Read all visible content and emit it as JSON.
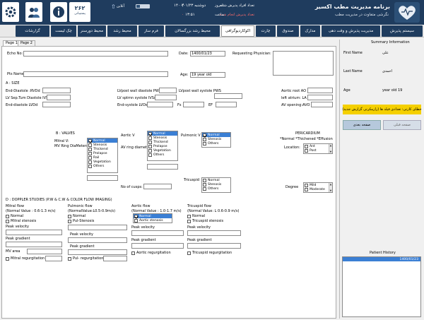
{
  "header": {
    "brand_title": "برنامه مدیریت مطب اکسیر",
    "brand_subtitle": "نگرشی متفاوت در مدیریت مطب",
    "queue_label": "تعداد افراد پذیرش شده",
    "queue_value": "۳",
    "done_label": "تعداد پذیرش انجام شده",
    "done_value": "۰",
    "today_label": "امروز:",
    "today_value": "دوشنبه ۱۴۰۰/۰۱/۲۳",
    "time_label": "ساعت",
    "time_value": "۱۳:۵۱",
    "badge_number": "۲۶۲",
    "badge_label": "پشتیبانی",
    "online_label": "آنلاین",
    "colors": {
      "header_bg": "#1f3c5e",
      "alert": "#ff6b6b"
    }
  },
  "menu": [
    {
      "label": "سیستم پذیرش"
    },
    {
      "label": "مدیریت پذیرش و وقت دهی"
    },
    {
      "label": "مدارک"
    },
    {
      "label": "صندوق"
    },
    {
      "label": "چارت"
    },
    {
      "label": "اکوکاردیوگرافی"
    },
    {
      "label": "محیط رشد بزرگسالان"
    },
    {
      "label": "فرم ساز"
    },
    {
      "label": "محیط رشد"
    },
    {
      "label": "محیط دورسنر"
    },
    {
      "label": "چک لیست"
    },
    {
      "label": "گزارشات"
    }
  ],
  "tabs": [
    "Page 1",
    "Page 2"
  ],
  "form": {
    "echo_no": "Echo No:",
    "date_label": "Date:",
    "date_value": "1400/01/23",
    "requesting_physician": "Requesting Physician:",
    "pts_name": "Pts Name:",
    "age_label": "Age:",
    "age_value": "19 year old",
    "section_a": "A : SIZE",
    "size_fields": {
      "end_diastole_rvd": "End-Diastole :RVDd",
      "lv_sep_tum": "LV Sep.Tum Diastole IVSd",
      "end_diastole_lvd": "End-diastole LVDd",
      "lv_post_wall_diastole": "LVpost wall diastole PWD",
      "lv_post_wall_systole": "LVpost wall systole PWS",
      "lv_sptmn_systole": "LV sptmn systole IVSs",
      "end_systole_lvd": "End-systole LVDs",
      "fs": "Fs",
      "ef": "EF",
      "aortic_root": "Aortic root AO",
      "left_atrium": "left atrium: LA",
      "av_opening": "AV opening:AVO"
    },
    "section_b": "B : VALVES",
    "mitral_v": "Mitral V:",
    "mv_ring": "MV Ring DiaMeters:",
    "mitral_options": [
      {
        "label": "Normal",
        "checked": true,
        "selected": true
      },
      {
        "label": "Stenosis",
        "checked": false
      },
      {
        "label": "Thickend",
        "checked": false
      },
      {
        "label": "Prolapse",
        "checked": false
      },
      {
        "label": "Rail",
        "checked": false
      },
      {
        "label": "Vegetation",
        "checked": false
      },
      {
        "label": "Others",
        "checked": false
      }
    ],
    "aortic_v": "Aortic V",
    "av_ring": "AV ring diameter:",
    "aortic_options": [
      {
        "label": "Normal",
        "checked": true,
        "selected": true
      },
      {
        "label": "Stenosis",
        "checked": false
      },
      {
        "label": "Thickend",
        "checked": false
      },
      {
        "label": "Prolapse",
        "checked": false
      },
      {
        "label": "Vegetation",
        "checked": false
      },
      {
        "label": "Others",
        "checked": false
      }
    ],
    "pulmonic_v": "Pulmonic V",
    "pulmonic_options": [
      {
        "label": "Normal",
        "checked": true,
        "selected": true
      },
      {
        "label": "Stenosis",
        "checked": false
      },
      {
        "label": "Others",
        "checked": false
      }
    ],
    "pericardium": "PERICARDIUM",
    "pericardium_opts": "*Normal  *Thichened  *Effusion",
    "location": "Location:",
    "location_options": [
      {
        "label": "Ant",
        "checked": false
      },
      {
        "label": "Post",
        "checked": false
      }
    ],
    "no_of_cusps": "No of cusps:",
    "tricuspid": "Tricuspid",
    "tricuspid_options": [
      {
        "label": "Normal",
        "checked": false
      },
      {
        "label": "Stenosis",
        "checked": false
      },
      {
        "label": "Others",
        "checked": false
      }
    ],
    "degree": "Degree",
    "degree_options": [
      {
        "label": "Mild",
        "checked": false
      },
      {
        "label": "Moderate",
        "checked": false
      }
    ],
    "section_d": "D : DOPPLER STUDIES (P.W & C.W & COLOR FLOW IMAGING)",
    "mitral_flow": {
      "title": "Mitral flow",
      "normal_value": "(Normal Value : 0.6-1.3 m/s)",
      "normal": "Normal",
      "stenosis": "Mitral stenosis",
      "peak_velocity": "Peak velocity",
      "peak_gradient": "Peak gradient",
      "mv_area": "MV area",
      "regurg": "Mitral regurgitation"
    },
    "pulmonic_flow": {
      "title": "Pulmonic flow",
      "normal_value": "(NormalValue:L0.5-0.9m/s)",
      "normal": "Normal",
      "stenosis": "Pul-Stenosis",
      "peak_velocity": "Peak velocity",
      "peak_gradient": "Peak gradient",
      "regurg": "Pul- regurgitation"
    },
    "aortic_flow": {
      "title": "Aortic flow",
      "normal_value": "(Normal Value : 1.0-1.7 m/s)",
      "normal": "Normal",
      "stenosis": "Aortic stenosis",
      "peak_velocity": "Peak velocity",
      "peak_gradient": "Peak gradient",
      "regurg": "Aortic regurgitation"
    },
    "tricuspid_flow": {
      "title": "Tricuspid flow",
      "normal_value": "(Normal Value: L 0.6-0.9 m/s)",
      "normal": "Normal",
      "stenosis": "Tricuspid stenosis",
      "peak_velocity": "Peak velocity",
      "peak_gradient": "Peak gradient",
      "regurg": "Tricuspid regurgitation"
    }
  },
  "summary": {
    "title": "Summary Information",
    "first_name_label": "First Name",
    "first_name_value": "علی",
    "last_name_label": "Last Name",
    "last_name_value": "احمدی",
    "age_label": "Age",
    "age_value": "year old 19",
    "warning_button": "خطای کارتی: تعدادی فیلد ها (رازمکرتی گزارش جدید)",
    "next_button": "صفحه بعدی",
    "prev_button": "صفحه قبلی",
    "history_title": "Patient History",
    "history_items": [
      "1400/01/23"
    ]
  }
}
